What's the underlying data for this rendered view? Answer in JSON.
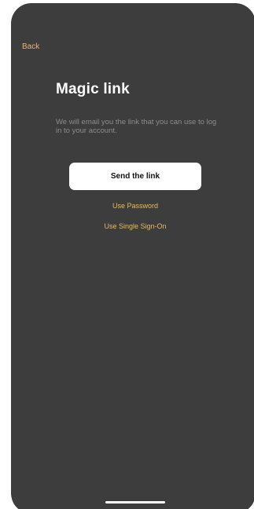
{
  "nav": {
    "back_label": "Back"
  },
  "main": {
    "title": "Magic link",
    "description": "We will email you the link that you can use to log in to your account.",
    "send_button_label": "Send the link",
    "use_password_label": "Use Password",
    "use_sso_label": "Use Single Sign-On"
  },
  "colors": {
    "background": "#000000",
    "accent": "#e8b86a",
    "primary_button": "#ffffff",
    "muted_text": "#8c8c8c",
    "device_frame": "#3d3d3d"
  }
}
